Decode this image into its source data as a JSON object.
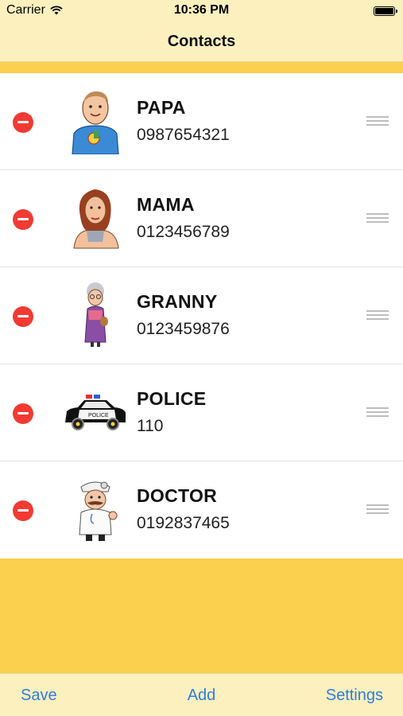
{
  "status_bar": {
    "carrier": "Carrier",
    "time": "10:36 PM"
  },
  "nav": {
    "title": "Contacts"
  },
  "contacts": [
    {
      "name": "PAPA",
      "phone": "0987654321",
      "avatar_icon": "father-cartoon-icon"
    },
    {
      "name": "MAMA",
      "phone": "0123456789",
      "avatar_icon": "mother-cartoon-icon"
    },
    {
      "name": "GRANNY",
      "phone": "0123459876",
      "avatar_icon": "granny-cartoon-icon"
    },
    {
      "name": "POLICE",
      "phone": "110",
      "avatar_icon": "police-car-icon"
    },
    {
      "name": "DOCTOR",
      "phone": "0192837465",
      "avatar_icon": "doctor-cartoon-icon"
    }
  ],
  "toolbar": {
    "save_label": "Save",
    "add_label": "Add",
    "settings_label": "Settings"
  },
  "colors": {
    "background": "#fcd04f",
    "bars": "#fbf0be",
    "delete": "#f23a32",
    "accent": "#2f7de1"
  }
}
